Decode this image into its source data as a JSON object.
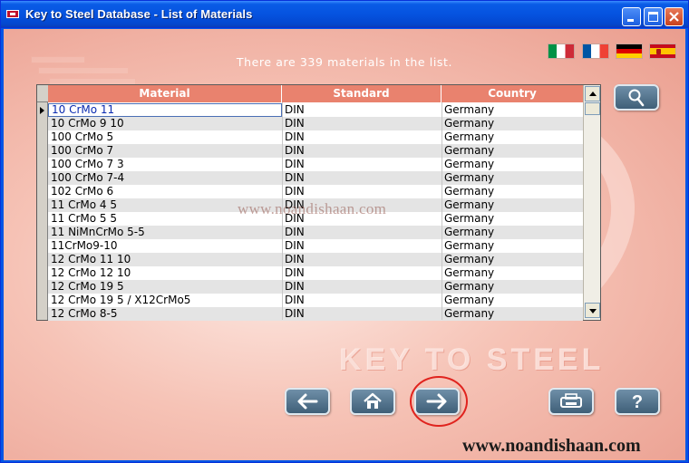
{
  "window": {
    "title": "Key to Steel Database - List of Materials"
  },
  "info": {
    "text": "There are 339 materials in the list."
  },
  "languages": [
    {
      "name": "Italian",
      "icon": "italy-flag-icon"
    },
    {
      "name": "French",
      "icon": "france-flag-icon"
    },
    {
      "name": "German",
      "icon": "germany-flag-icon"
    },
    {
      "name": "Spanish",
      "icon": "spain-flag-icon"
    }
  ],
  "table": {
    "headers": [
      "Material",
      "Standard",
      "Country"
    ],
    "selected_row": 0,
    "rows": [
      [
        "10 CrMo 11",
        "DIN",
        "Germany"
      ],
      [
        "10 CrMo 9 10",
        "DIN",
        "Germany"
      ],
      [
        "100 CrMo 5",
        "DIN",
        "Germany"
      ],
      [
        "100 CrMo 7",
        "DIN",
        "Germany"
      ],
      [
        "100 CrMo 7 3",
        "DIN",
        "Germany"
      ],
      [
        "100 CrMo 7-4",
        "DIN",
        "Germany"
      ],
      [
        "102 CrMo 6",
        "DIN",
        "Germany"
      ],
      [
        "11 CrMo 4 5",
        "DIN",
        "Germany"
      ],
      [
        "11 CrMo 5 5",
        "DIN",
        "Germany"
      ],
      [
        "11 NiMnCrMo 5-5",
        "DIN",
        "Germany"
      ],
      [
        "11CrMo9-10",
        "DIN",
        "Germany"
      ],
      [
        "12 CrMo 11 10",
        "DIN",
        "Germany"
      ],
      [
        "12 CrMo 12 10",
        "DIN",
        "Germany"
      ],
      [
        "12 CrMo 19 5",
        "DIN",
        "Germany"
      ],
      [
        "12 CrMo 19 5 / X12CrMo5",
        "DIN",
        "Germany"
      ],
      [
        "12 CrMo 8-5",
        "DIN",
        "Germany"
      ]
    ]
  },
  "buttons": {
    "search_icon": "magnifier-icon",
    "back_icon": "arrow-left-icon",
    "home_icon": "home-icon",
    "next_icon": "arrow-right-icon",
    "print_icon": "printer-icon",
    "help_label": "?"
  },
  "branding": {
    "background_text": "KEY TO STEEL"
  },
  "watermarks": {
    "middle": "www.noandishaan.com",
    "bottom": "www.noandishaan.com"
  },
  "colors": {
    "header_bg": "#e9826e",
    "client_bg": "#f6c3b6",
    "button_bg": "#4f6f88",
    "highlight_ring": "#e0231e"
  }
}
